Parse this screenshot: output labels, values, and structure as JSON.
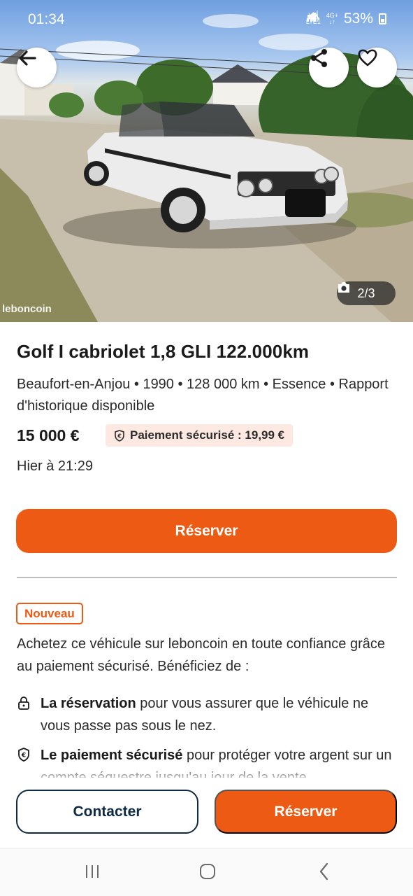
{
  "status_bar": {
    "time": "01:34",
    "network_top": "Vo)",
    "network_bottom": "LTE1",
    "network_type": "4G+",
    "battery": "53%"
  },
  "header": {
    "back_icon": "arrow-left-icon",
    "share_icon": "share-icon",
    "favorite_icon": "heart-icon"
  },
  "gallery": {
    "counter": "2/3",
    "camera_icon": "camera-icon",
    "watermark": "leboncoin"
  },
  "listing": {
    "title": "Golf I cabriolet 1,8 GLI 122.000km",
    "meta": "Beaufort-en-Anjou • 1990 • 128 000 km • Essence • Rapport d'historique disponible",
    "price": "15 000 €",
    "secure_payment": "Paiement sécurisé : 19,99 €",
    "date": "Hier à 21:29"
  },
  "reserve_main_label": "Réserver",
  "promo": {
    "badge": "Nouveau",
    "intro": "Achetez ce véhicule sur leboncoin en toute confiance grâce au paiement sécurisé. Bénéficiez de :",
    "features": [
      {
        "icon": "lock-icon",
        "bold": "La réservation",
        "text": " pour vous assurer que le véhicule ne vous passe pas sous le nez."
      },
      {
        "icon": "euro-shield-icon",
        "bold": "Le paiement sécurisé",
        "text": " pour protéger votre argent sur un compte séquestre jusqu'au jour de la vente"
      }
    ]
  },
  "actions": {
    "contact": "Contacter",
    "reserve": "Réserver"
  },
  "colors": {
    "accent": "#ec5a13",
    "dark_blue": "#0f2a44",
    "chip_bg": "#fde9e1"
  },
  "navigation": {
    "recent_icon": "recent-apps-icon",
    "home_icon": "home-icon",
    "back_icon": "back-icon"
  }
}
